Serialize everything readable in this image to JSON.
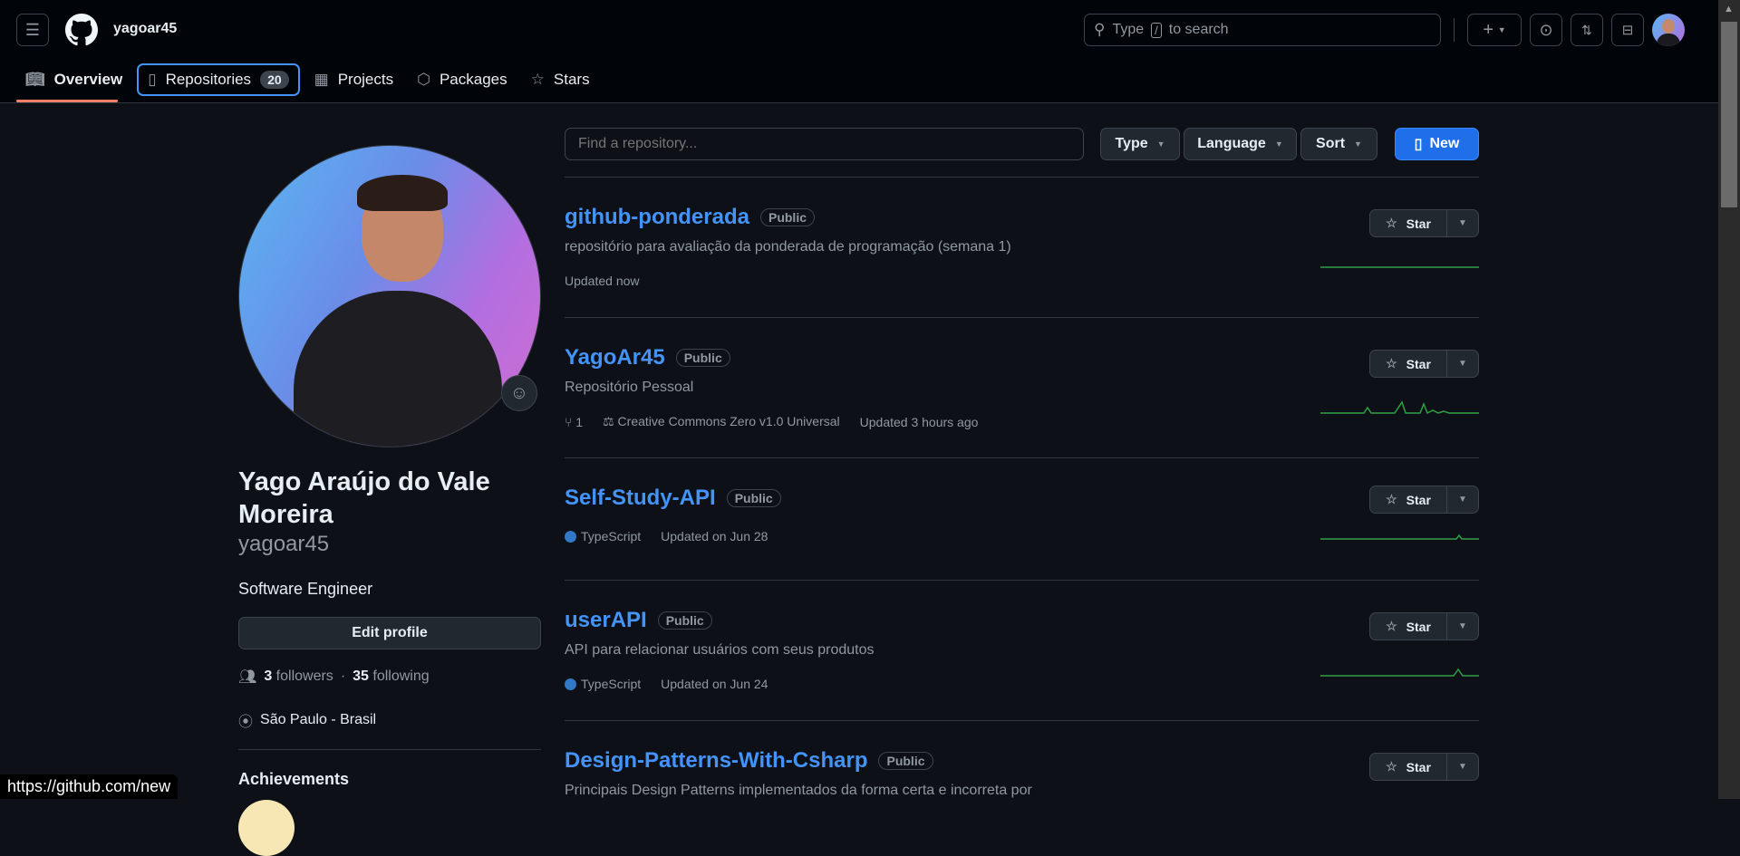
{
  "header": {
    "username": "yagoar45",
    "search_prefix": "Type",
    "search_key": "/",
    "search_suffix": "to search"
  },
  "nav": {
    "tabs": [
      {
        "label": "Overview"
      },
      {
        "label": "Repositories",
        "count": "20"
      },
      {
        "label": "Projects"
      },
      {
        "label": "Packages"
      },
      {
        "label": "Stars"
      }
    ]
  },
  "profile": {
    "name": "Yago Araújo do Vale Moreira",
    "username": "yagoar45",
    "bio": "Software Engineer",
    "edit_label": "Edit profile",
    "followers": "3",
    "followers_label": "followers",
    "separator": "·",
    "following": "35",
    "following_label": "following",
    "location": "São Paulo - Brasil",
    "achievements_title": "Achievements"
  },
  "filters": {
    "placeholder": "Find a repository...",
    "type": "Type",
    "language": "Language",
    "sort": "Sort",
    "new": "New"
  },
  "repos": [
    {
      "name": "github-ponderada",
      "visibility": "Public",
      "description": "repositório para avaliação da ponderada de programação (semana 1)",
      "updated": "Updated now",
      "star": "Star"
    },
    {
      "name": "YagoAr45",
      "visibility": "Public",
      "description": "Repositório Pessoal",
      "forks": "1",
      "license": "Creative Commons Zero v1.0 Universal",
      "updated": "Updated 3 hours ago",
      "star": "Star"
    },
    {
      "name": "Self-Study-API",
      "visibility": "Public",
      "language": "TypeScript",
      "updated": "Updated on Jun 28",
      "star": "Star"
    },
    {
      "name": "userAPI",
      "visibility": "Public",
      "description": "API para relacionar usuários com seus produtos",
      "language": "TypeScript",
      "updated": "Updated on Jun 24",
      "star": "Star"
    },
    {
      "name": "Design-Patterns-With-Csharp",
      "visibility": "Public",
      "description": "Principais Design Patterns implementados da forma certa e incorreta por",
      "star": "Star"
    }
  ],
  "colors": {
    "accent": "#4493f8",
    "new_button": "#1f6feb",
    "typescript": "#3178c6",
    "spark": "#2ea043"
  },
  "status_url": "https://github.com/new"
}
